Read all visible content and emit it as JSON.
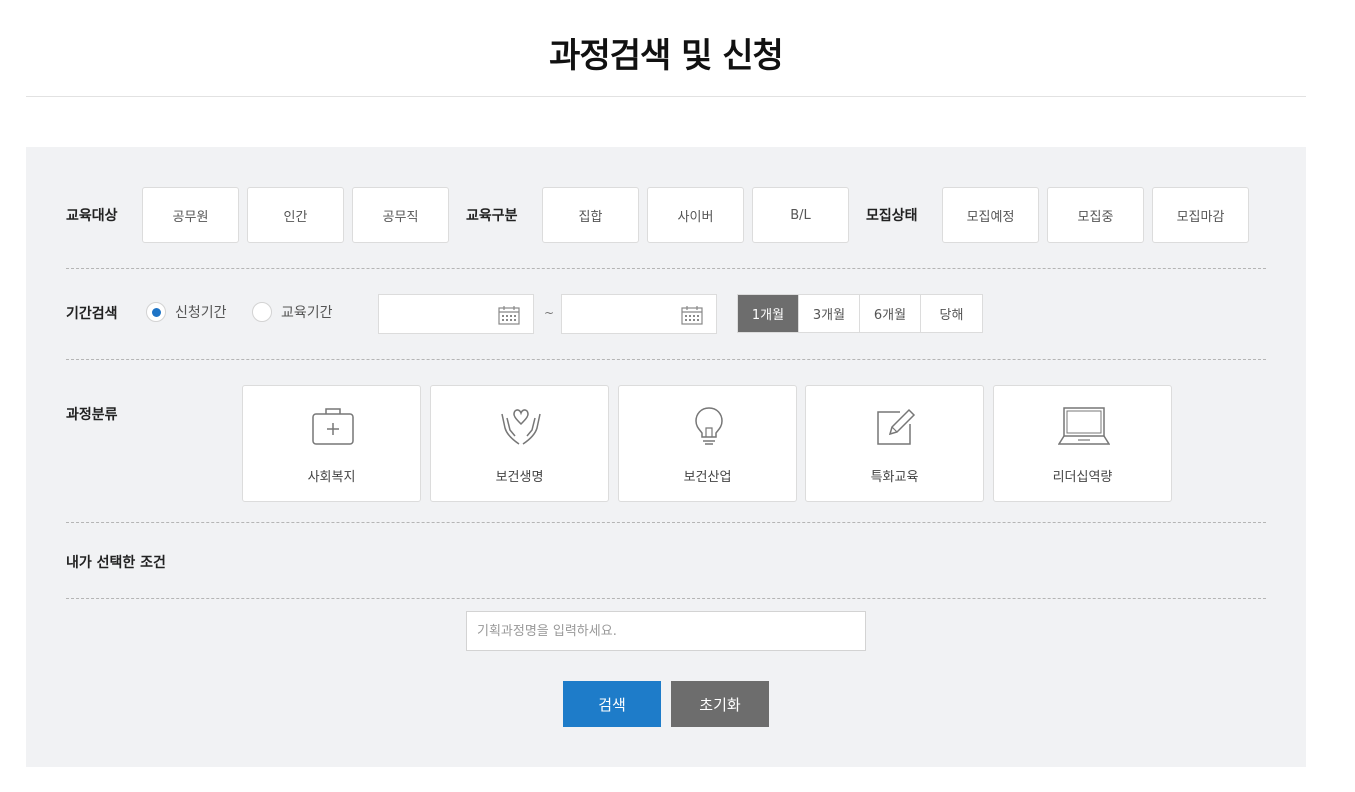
{
  "page": {
    "title": "과정검색 및 신청"
  },
  "filters": {
    "target": {
      "label": "교육대상",
      "options": [
        "공무원",
        "인간",
        "공무직"
      ]
    },
    "type": {
      "label": "교육구분",
      "options": [
        "집합",
        "사이버",
        "B/L"
      ]
    },
    "status": {
      "label": "모집상태",
      "options": [
        "모집예정",
        "모집중",
        "모집마감"
      ]
    }
  },
  "period": {
    "label": "기간검색",
    "radios": [
      {
        "label": "신청기간",
        "checked": true
      },
      {
        "label": "교육기간",
        "checked": false
      }
    ],
    "range_separator": "~",
    "quick": [
      {
        "label": "1개월",
        "active": true
      },
      {
        "label": "3개월",
        "active": false
      },
      {
        "label": "6개월",
        "active": false
      },
      {
        "label": "당해",
        "active": false
      }
    ]
  },
  "category": {
    "label": "과정분류",
    "items": [
      {
        "label": "사회복지",
        "icon": "medical-kit-icon"
      },
      {
        "label": "보건생명",
        "icon": "hands-heart-icon"
      },
      {
        "label": "보건산업",
        "icon": "lightbulb-icon"
      },
      {
        "label": "특화교육",
        "icon": "edit-note-icon"
      },
      {
        "label": "리더십역량",
        "icon": "laptop-icon"
      }
    ]
  },
  "selected": {
    "label": "내가 선택한 조건"
  },
  "search": {
    "placeholder": "기획과정명을 입력하세요.",
    "submit_label": "검색",
    "reset_label": "초기화"
  },
  "colors": {
    "primary": "#1e7cc9",
    "secondary": "#6d6d6d",
    "panel_bg": "#f1f2f4"
  }
}
